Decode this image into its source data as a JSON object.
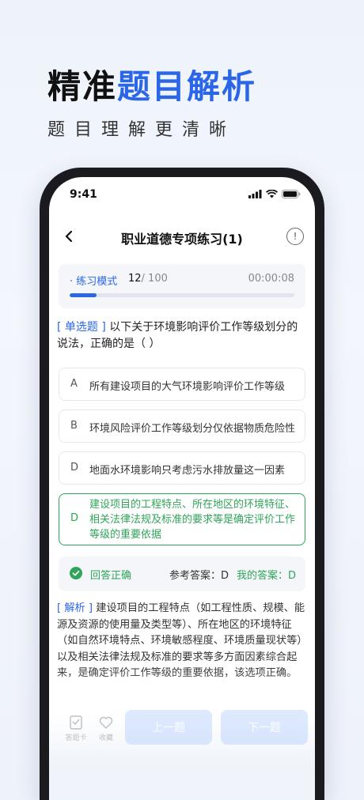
{
  "hero": {
    "title_dark": "精准",
    "title_blue": "题目解析",
    "subtitle": "题目理解更清晰"
  },
  "status": {
    "time": "9:41"
  },
  "nav": {
    "title": "职业道德专项练习(1)",
    "info": "!"
  },
  "progress": {
    "mode": "· 练习模式",
    "current": "12",
    "total": "/ 100",
    "timer": "00:00:08",
    "fraction": 0.12
  },
  "question": {
    "tag": "[ 单选题 ]",
    "text": " 以下关于环境影响评价工作等级划分的说法，正确的是（   ）"
  },
  "options": [
    {
      "letter": "A",
      "text": "所有建设项目的大气环境影响评价工作等级"
    },
    {
      "letter": "B",
      "text": "环境风险评价工作等级划分仅依据物质危险性"
    },
    {
      "letter": "D",
      "text": "地面水环境影响只考虑污水排放量这一因素"
    },
    {
      "letter": "D",
      "text": "建设项目的工程特点、所在地区的环境特征、相关法律法规及标准的要求等是确定评价工作等级的重要依据"
    }
  ],
  "result": {
    "status": "回答正确",
    "reference": "参考答案：D",
    "mine": "我的答案：D"
  },
  "analysis": {
    "tag": "[ 解析 ]",
    "text": " 建设项目的工程特点（如工程性质、规模、能源及资源的使用量及类型等）、所在地区的环境特征（如自然环境特点、环境敏感程度、环境质量现状等）以及相关法律法规及标准的要求等多方面因素综合起来，是确定评价工作等级的重要依据，该选项正确。"
  },
  "bottom": {
    "card_label": "答题卡",
    "fav_label": "收藏",
    "prev": "上一题",
    "next": "下一题"
  },
  "colors": {
    "accent": "#2b66e6",
    "correct": "#2fa55a"
  }
}
